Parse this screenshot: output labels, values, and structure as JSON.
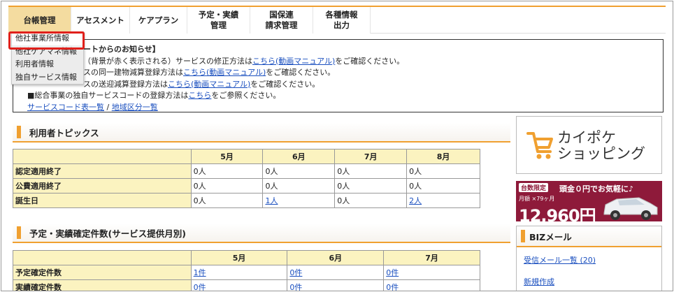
{
  "nav": {
    "items": [
      {
        "label": "台帳管理",
        "active": true
      },
      {
        "label": "アセスメント"
      },
      {
        "label": "ケアプラン"
      },
      {
        "label": "予定・実績\n管理"
      },
      {
        "label": "国保連\n請求管理"
      },
      {
        "label": "各種情報\n出力"
      }
    ]
  },
  "dropdown": {
    "items": [
      "他社事業所情報",
      "他社ケアマネ情報",
      "利用者情報",
      "独自サービス情報"
    ]
  },
  "notice": {
    "title": "ートからのお知らせ】",
    "lines": [
      {
        "pre": "（背景が赤く表示される）サービスの修正方法は",
        "link": "こちら(動画マニュアル)",
        "post": "をご確認ください。"
      },
      {
        "pre": "スの同一建物減算登録方法は",
        "link": "こちら(動画マニュアル)",
        "post": "をご確認ください。"
      },
      {
        "pre": "スの送迎減算登録方法は",
        "link": "こちら(動画マニュアル)",
        "post": "をご確認ください。"
      },
      {
        "pre": "■総合事業の独自サービスコードの登録方法は",
        "link": "こちら",
        "post": "をご参照ください。"
      }
    ],
    "bottom_link1": "サービスコード表一覧",
    "sep": "/",
    "bottom_link2": "地域区分一覧"
  },
  "topics": {
    "title": "利用者トピックス",
    "months": [
      "5月",
      "6月",
      "7月",
      "8月"
    ],
    "rows": [
      {
        "label": "認定適用終了",
        "cells": [
          "0人",
          "0人",
          "0人",
          "0人"
        ],
        "links": [
          false,
          false,
          false,
          false
        ]
      },
      {
        "label": "公費適用終了",
        "cells": [
          "0人",
          "0人",
          "0人",
          "0人"
        ],
        "links": [
          false,
          false,
          false,
          false
        ]
      },
      {
        "label": "誕生日",
        "cells": [
          "0人",
          "1人",
          "0人",
          "2人"
        ],
        "links": [
          false,
          true,
          false,
          true
        ]
      }
    ]
  },
  "confirmed": {
    "title": "予定・実績確定件数(サービス提供月別)",
    "months": [
      "5月",
      "6月",
      "7月"
    ],
    "rows": [
      {
        "label": "予定確定件数",
        "cells": [
          "1件",
          "0件",
          "0件"
        ]
      },
      {
        "label": "実績確定件数",
        "cells": [
          "0件",
          "0件",
          "0件"
        ]
      }
    ]
  },
  "shop": {
    "label_line1": "カイポケ",
    "label_line2": "ショッピング"
  },
  "banner": {
    "tag": "台数限定",
    "top": "頭金０円でお気軽に♪",
    "small": "月額 ×79ヶ月",
    "price": "12,960円"
  },
  "biz": {
    "title": "BIZメール",
    "inbox": "受信メール一覧 (20)",
    "compose": "新規作成"
  },
  "colors": {
    "accent": "#f0a030",
    "header_bg": "#fbf3c0",
    "link": "#1a4fbf",
    "highlight": "#e0201b"
  }
}
